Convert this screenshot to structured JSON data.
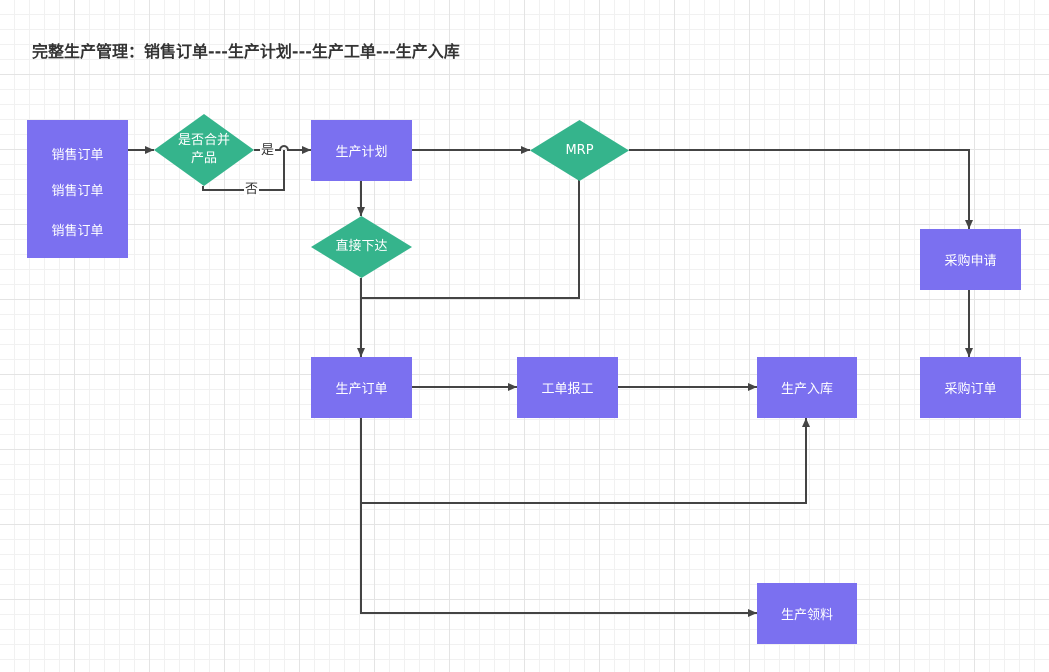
{
  "title": "完整生产管理：销售订单---生产计划---生产工单---生产入库",
  "nodes": {
    "sales_orders": [
      "销售订单",
      "销售订单",
      "销售订单"
    ],
    "merge_decision": [
      "是否合并",
      "产品"
    ],
    "production_plan": "生产计划",
    "mrp": "MRP",
    "direct_issue": "直接下达",
    "purchase_request": "采购申请",
    "production_order": "生产订单",
    "work_report": "工单报工",
    "production_receipt": "生产入库",
    "purchase_order": "采购订单",
    "material_issue": "生产领料"
  },
  "edge_labels": {
    "yes": "是",
    "no": "否"
  },
  "colors": {
    "process": "#7b70f0",
    "decision": "#35b48c",
    "line": "#444444"
  }
}
